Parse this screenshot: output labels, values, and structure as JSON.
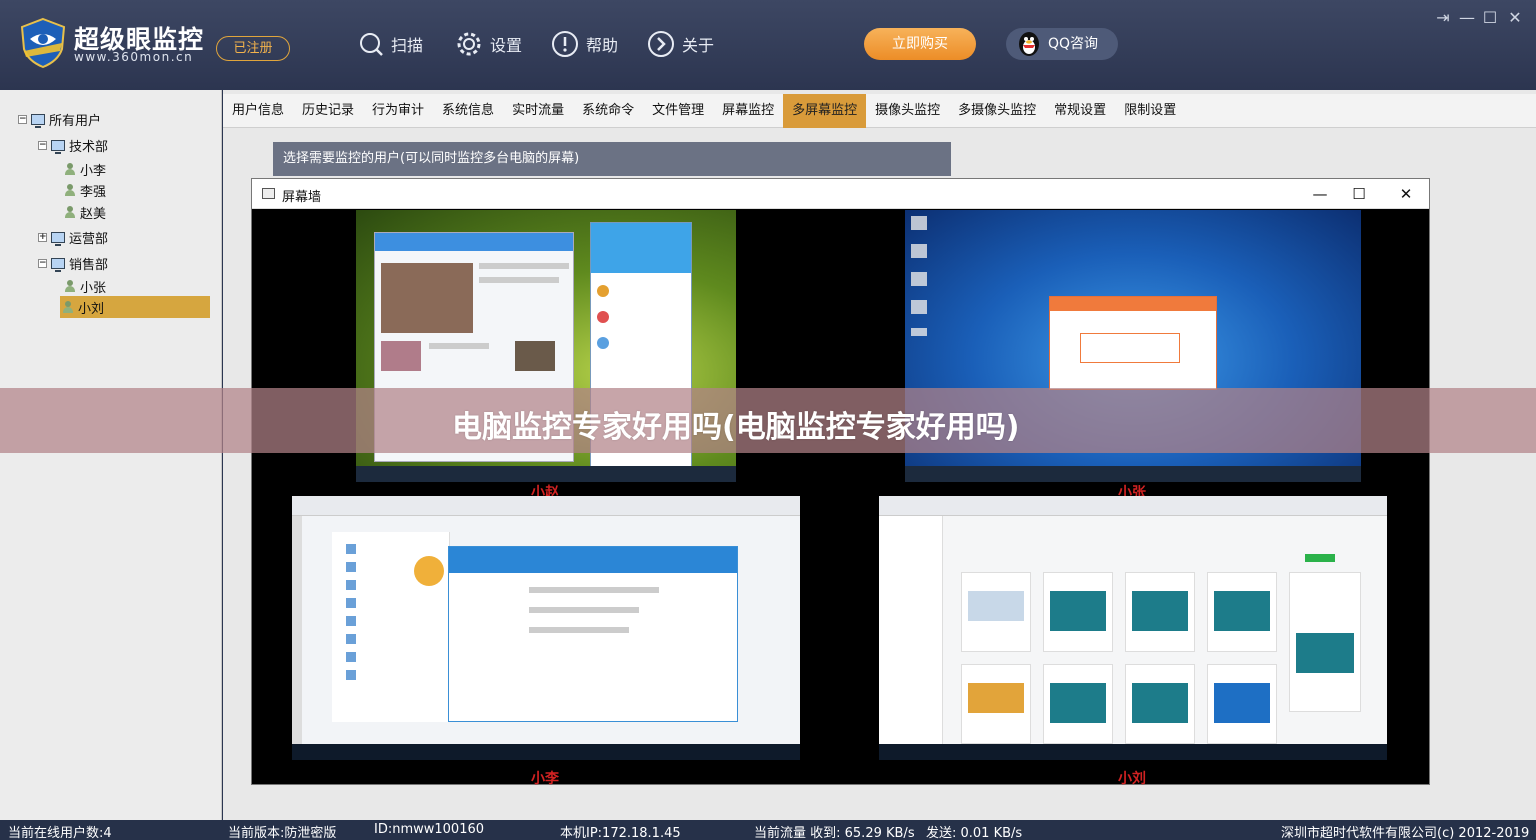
{
  "app": {
    "title": "超级眼监控",
    "url": "www.360mon.cn",
    "registered_label": "已注册",
    "nav": [
      {
        "label": "扫描",
        "icon": "scan-icon"
      },
      {
        "label": "设置",
        "icon": "gear-icon"
      },
      {
        "label": "帮助",
        "icon": "help-icon"
      },
      {
        "label": "关于",
        "icon": "about-icon"
      }
    ],
    "buy_label": "立即购买",
    "qq_label": "QQ咨询"
  },
  "tree": {
    "root": "所有用户",
    "groups": [
      {
        "name": "技术部",
        "expanded": true,
        "users": [
          "小李",
          "李强",
          "赵美"
        ]
      },
      {
        "name": "运营部",
        "expanded": false,
        "users": []
      },
      {
        "name": "销售部",
        "expanded": true,
        "users": [
          "小张",
          "小刘"
        ]
      }
    ],
    "selected": "小刘"
  },
  "tabs": [
    "用户信息",
    "历史记录",
    "行为审计",
    "系统信息",
    "实时流量",
    "系统命令",
    "文件管理",
    "屏幕监控",
    "多屏幕监控",
    "摄像头监控",
    "多摄像头监控",
    "常规设置",
    "限制设置"
  ],
  "active_tab": "多屏幕监控",
  "select_hint": "选择需要监控的用户(可以同时监控多台电脑的屏幕)",
  "wall": {
    "title": "屏幕墙",
    "screens": [
      {
        "label": "小赵"
      },
      {
        "label": "小张"
      },
      {
        "label": "小李"
      },
      {
        "label": "小刘"
      }
    ]
  },
  "overlay_text": "电脑监控专家好用吗(电脑监控专家好用吗)",
  "status": {
    "online": "当前在线用户数:4",
    "version": "当前版本:防泄密版",
    "id": "ID:nmww100160",
    "ip": "本机IP:172.18.1.45",
    "traffic_in": "当前流量 收到: 65.29 KB/s",
    "traffic_out": "发送: 0.01 KB/s",
    "copyright": "深圳市超时代软件有限公司(c) 2012-2019"
  },
  "colors": {
    "accent": "#d99b3a",
    "header": "#333d58",
    "screen_label": "#d12222"
  }
}
